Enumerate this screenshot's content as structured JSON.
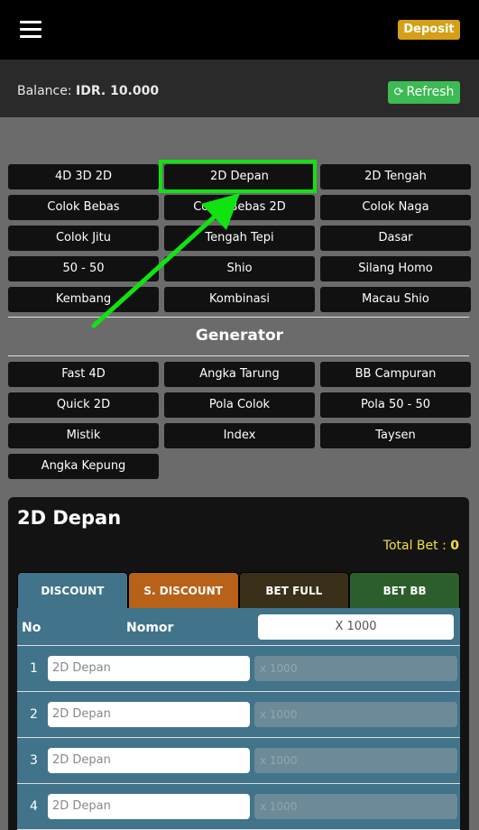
{
  "topbar": {
    "deposit_label": "Deposit"
  },
  "balance": {
    "label": "Balance:",
    "value": "IDR. 10.000",
    "refresh_label": "Refresh"
  },
  "games": [
    "4D 3D 2D",
    "2D Depan",
    "2D Tengah",
    "Colok Bebas",
    "Colok Bebas 2D",
    "Colok Naga",
    "Colok Jitu",
    "Tengah Tepi",
    "Dasar",
    "50 - 50",
    "Shio",
    "Silang Homo",
    "Kembang",
    "Kombinasi",
    "Macau Shio"
  ],
  "generator": {
    "title": "Generator",
    "items": [
      "Fast 4D",
      "Angka Tarung",
      "BB Campuran",
      "Quick 2D",
      "Pola Colok",
      "Pola 50 - 50",
      "Mistik",
      "Index",
      "Taysen",
      "Angka Kepung"
    ]
  },
  "panel": {
    "title": "2D Depan",
    "total_bet_label": "Total Bet :",
    "total_bet_value": "0",
    "tabs": [
      "DISCOUNT",
      "S. DISCOUNT",
      "BET FULL",
      "BET BB"
    ],
    "col_no": "No",
    "col_nomor": "Nomor",
    "multiplier": "X 1000",
    "rows": [
      {
        "no": "1",
        "placeholder": "2D Depan",
        "bet_placeholder": "x 1000"
      },
      {
        "no": "2",
        "placeholder": "2D Depan",
        "bet_placeholder": "x 1000"
      },
      {
        "no": "3",
        "placeholder": "2D Depan",
        "bet_placeholder": "x 1000"
      },
      {
        "no": "4",
        "placeholder": "2D Depan",
        "bet_placeholder": "x 1000"
      }
    ]
  },
  "colors": {
    "highlight": "#11e311",
    "deposit": "#d4a017",
    "refresh": "#3cba54",
    "total_bet": "#f0e040"
  }
}
